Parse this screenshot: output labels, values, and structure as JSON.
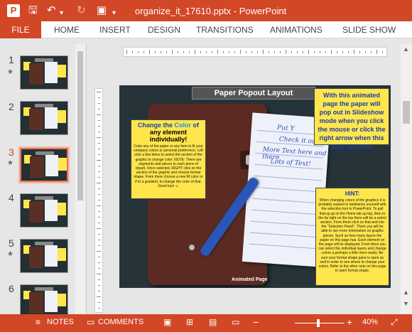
{
  "window": {
    "title": "organize_it_17610.pptx - PowerPoint",
    "app_icon_letter": "P",
    "quick_access": [
      "save-icon",
      "undo-icon",
      "redo-icon",
      "slideshow-icon"
    ]
  },
  "ribbon": {
    "file_label": "FILE",
    "tabs": [
      "HOME",
      "INSERT",
      "DESIGN",
      "TRANSITIONS",
      "ANIMATIONS",
      "SLIDE SHOW"
    ]
  },
  "thumbnails": [
    {
      "number": "1",
      "star": "★",
      "selected": false
    },
    {
      "number": "2",
      "star": "",
      "selected": false
    },
    {
      "number": "3",
      "star": "★",
      "selected": true
    },
    {
      "number": "4",
      "star": "",
      "selected": false
    },
    {
      "number": "5",
      "star": "★",
      "selected": false
    },
    {
      "number": "6",
      "star": "",
      "selected": false
    }
  ],
  "slide": {
    "title": "Paper Popout Layout",
    "left_callout": {
      "line1_a": "Change the ",
      "line1_b": "Color",
      "line1_c": " of",
      "line2": "any element individually!",
      "body": "Color any of the paper or any item to fit your company colors or personal preference. Left click a few times to select the section of the graphic to change color. NOTE: There are segments and pieces to each piece of clipart. Once selected, RIGHT click on the section of the graphic and choose format shape. From there choose a new fill color or if to a gradient, to change the color of that. Good luck ☺"
    },
    "top_right_callout": "With this animated page the paper will pop out in Slideshow mode when you click the mouse or click the right arrow when this page appears.",
    "bottom_right_callout": {
      "heading": "HINT:",
      "body": "When changing colors of the graphics it is probably easiest to familiarize yourself with the selection tool in PowerPoint. To pull that up go to the Home tab up top, then to the far right on the top there will be a select section. From there click on that and into the \"Selection Panel\". There you will be able to see more information on graphic pieces. Such as how many layers the paper on this page has. Each element on the page will be displayed. From there you can select the individual layers and change colors a perhaps a little more easily. Be sure your format shape pane is open as well in order to see where to change your colors. Refer to the other note on this page to open format shape."
    },
    "paper_text": [
      "Put Y",
      "Check it out",
      "More Text here and there",
      "Lots of Text!"
    ],
    "footer": "Animated Page"
  },
  "statusbar": {
    "notes_label": "NOTES",
    "comments_label": "COMMENTS",
    "zoom_minus": "−",
    "zoom_plus": "+",
    "zoom_level": "40%"
  }
}
